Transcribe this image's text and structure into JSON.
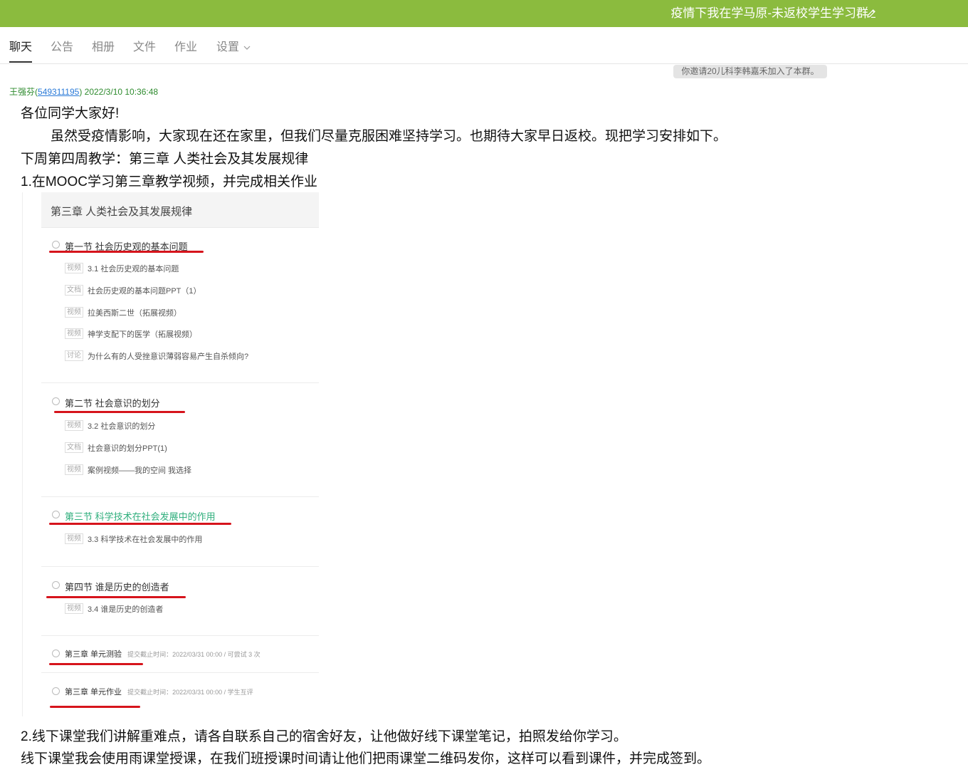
{
  "header": {
    "group_name": "疫情下我在学马原-未返校学生学习群",
    "bg_color": "#8bbb3e",
    "edit_icon": "pencil-edit-icon"
  },
  "tabs": [
    {
      "label": "聊天",
      "active": true
    },
    {
      "label": "公告"
    },
    {
      "label": "相册"
    },
    {
      "label": "文件"
    },
    {
      "label": "作业"
    },
    {
      "label": "设置"
    }
  ],
  "system_notice": "你邀请20儿科李韩嘉禾加入了本群。",
  "message": {
    "sender_name": "王强芬",
    "sender_qq": "549311195",
    "timestamp": "2022/3/10 10:36:48",
    "lines": [
      "各位同学大家好!",
      "虽然受疫情影响，大家现在还在家里，但我们尽量克服困难坚持学习。也期待大家早日返校。现把学习安排如下。",
      "下周第四周教学：第三章 人类社会及其发展规律",
      "1.在MOOC学习第三章教学视频，并完成相关作业",
      "2.线下课堂我们讲解重难点，请各自联系自己的宿舍好友，让他做好线下课堂笔记，拍照发给你学习。",
      "线下课堂我会使用雨课堂授课，在我们班授课时间请让他们把雨课堂二维码发你，这样可以看到课件，并完成签到。"
    ]
  },
  "embedded_image": {
    "chapter_title": "第三章 人类社会及其发展规律",
    "sections": [
      {
        "title": "第一节 社会历史观的基本问题",
        "items": [
          {
            "tag": "视频",
            "text": "3.1  社会历史观的基本问题"
          },
          {
            "tag": "文档",
            "text": "社会历史观的基本问题PPT（1）"
          },
          {
            "tag": "视频",
            "text": "拉美西斯二世（拓展视频）"
          },
          {
            "tag": "视频",
            "text": "神学支配下的医学（拓展视频）"
          },
          {
            "tag": "讨论",
            "text": "为什么有的人受挫意识薄弱容易产生自杀倾向?"
          }
        ]
      },
      {
        "title": "第二节 社会意识的划分",
        "items": [
          {
            "tag": "视频",
            "text": "3.2  社会意识的划分"
          },
          {
            "tag": "文档",
            "text": "社会意识的划分PPT(1)"
          },
          {
            "tag": "视频",
            "text": "案例视频——我的空间  我选择"
          }
        ]
      },
      {
        "title": "第三节 科学技术在社会发展中的作用",
        "highlight_color": "#2fae7c",
        "items": [
          {
            "tag": "视频",
            "text": "3.3  科学技术在社会发展中的作用"
          }
        ]
      },
      {
        "title": "第四节 谁是历史的创造者",
        "items": [
          {
            "tag": "视频",
            "text": "3.4    谁是历史的创造者"
          }
        ]
      },
      {
        "title": "第三章 单元测验",
        "deadline": "提交截止时间：2022/03/31 00:00 / 可尝试 3 次",
        "items": []
      },
      {
        "title": "第三章 单元作业",
        "deadline": "提交截止时间：2022/03/31 00:00 / 学生互评",
        "items": []
      }
    ]
  }
}
